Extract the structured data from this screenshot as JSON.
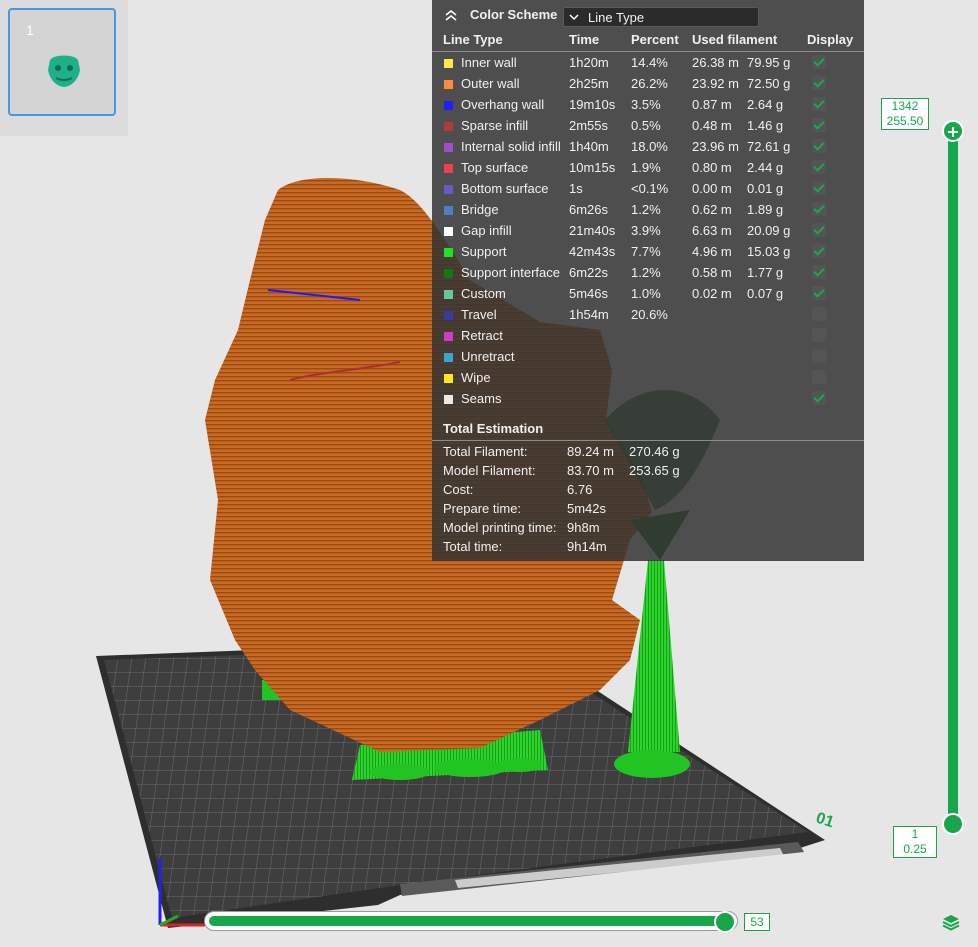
{
  "plate": {
    "number": "1"
  },
  "panel": {
    "title": "Color Scheme",
    "scheme_value": "Line Type",
    "headers": {
      "line_type": "Line Type",
      "time": "Time",
      "percent": "Percent",
      "used_filament": "Used filament",
      "display": "Display"
    },
    "rows": [
      {
        "name": "Inner wall",
        "time": "1h20m",
        "percent": "14.4%",
        "meters": "26.38 m",
        "grams": "79.95 g",
        "color": "#ffe84d",
        "checked": true
      },
      {
        "name": "Outer wall",
        "time": "2h25m",
        "percent": "26.2%",
        "meters": "23.92 m",
        "grams": "72.50 g",
        "color": "#ff8a3a",
        "checked": true
      },
      {
        "name": "Overhang wall",
        "time": "19m10s",
        "percent": "3.5%",
        "meters": "0.87 m",
        "grams": "2.64 g",
        "color": "#1f1fff",
        "checked": true
      },
      {
        "name": "Sparse infill",
        "time": "2m55s",
        "percent": "0.5%",
        "meters": "0.48 m",
        "grams": "1.46 g",
        "color": "#b33a3a",
        "checked": true
      },
      {
        "name": "Internal solid infill",
        "time": "1h40m",
        "percent": "18.0%",
        "meters": "23.96 m",
        "grams": "72.61 g",
        "color": "#9b4fcf",
        "checked": true
      },
      {
        "name": "Top surface",
        "time": "10m15s",
        "percent": "1.9%",
        "meters": "0.80 m",
        "grams": "2.44 g",
        "color": "#f0404a",
        "checked": true
      },
      {
        "name": "Bottom surface",
        "time": "1s",
        "percent": "<0.1%",
        "meters": "0.00 m",
        "grams": "0.01 g",
        "color": "#6659c8",
        "checked": true
      },
      {
        "name": "Bridge",
        "time": "6m26s",
        "percent": "1.2%",
        "meters": "0.62 m",
        "grams": "1.89 g",
        "color": "#4d80c0",
        "checked": true
      },
      {
        "name": "Gap infill",
        "time": "21m40s",
        "percent": "3.9%",
        "meters": "6.63 m",
        "grams": "20.09 g",
        "color": "#ffffff",
        "checked": true
      },
      {
        "name": "Support",
        "time": "42m43s",
        "percent": "7.7%",
        "meters": "4.96 m",
        "grams": "15.03 g",
        "color": "#22e022",
        "checked": true
      },
      {
        "name": "Support interface",
        "time": "6m22s",
        "percent": "1.2%",
        "meters": "0.58 m",
        "grams": "1.77 g",
        "color": "#0f7a0f",
        "checked": true
      },
      {
        "name": "Custom",
        "time": "5m46s",
        "percent": "1.0%",
        "meters": "0.02 m",
        "grams": "0.07 g",
        "color": "#5dcaa0",
        "checked": true
      },
      {
        "name": "Travel",
        "time": "1h54m",
        "percent": "20.6%",
        "meters": "",
        "grams": "",
        "color": "#3a3aa0",
        "checked": false
      },
      {
        "name": "Retract",
        "time": "",
        "percent": "",
        "meters": "",
        "grams": "",
        "color": "#d03cc8",
        "checked": false
      },
      {
        "name": "Unretract",
        "time": "",
        "percent": "",
        "meters": "",
        "grams": "",
        "color": "#3aa6d0",
        "checked": false
      },
      {
        "name": "Wipe",
        "time": "",
        "percent": "",
        "meters": "",
        "grams": "",
        "color": "#ffe81a",
        "checked": false
      },
      {
        "name": "Seams",
        "time": "",
        "percent": "",
        "meters": "",
        "grams": "",
        "color": "#eaeaea",
        "checked": true
      }
    ],
    "total_title": "Total Estimation",
    "totals": [
      {
        "label": "Total Filament:",
        "value": "89.24 m",
        "value2": "270.46 g"
      },
      {
        "label": "Model Filament:",
        "value": "83.70 m",
        "value2": "253.65 g"
      },
      {
        "label": "Cost:",
        "value": "6.76",
        "value2": ""
      },
      {
        "label": "Prepare time:",
        "value": "5m42s",
        "value2": ""
      },
      {
        "label": "Model printing time:",
        "value": "9h8m",
        "value2": ""
      },
      {
        "label": "Total time:",
        "value": "9h14m",
        "value2": ""
      }
    ]
  },
  "vslider": {
    "top_layer": "1342",
    "top_height": "255.50",
    "bottom_layer": "1",
    "bottom_height": "0.25"
  },
  "hslider": {
    "value": "53",
    "fill_fraction": 0.97
  },
  "plate_label": {
    "number": "01"
  },
  "icons": {
    "collapse": "chevron-up-double-icon",
    "dropdown": "chevron-down-icon",
    "layers": "layers-icon"
  },
  "colors": {
    "accent": "#17a64a",
    "model": "#c8621d",
    "support": "#22c422",
    "bed": "#3c3c3c"
  }
}
